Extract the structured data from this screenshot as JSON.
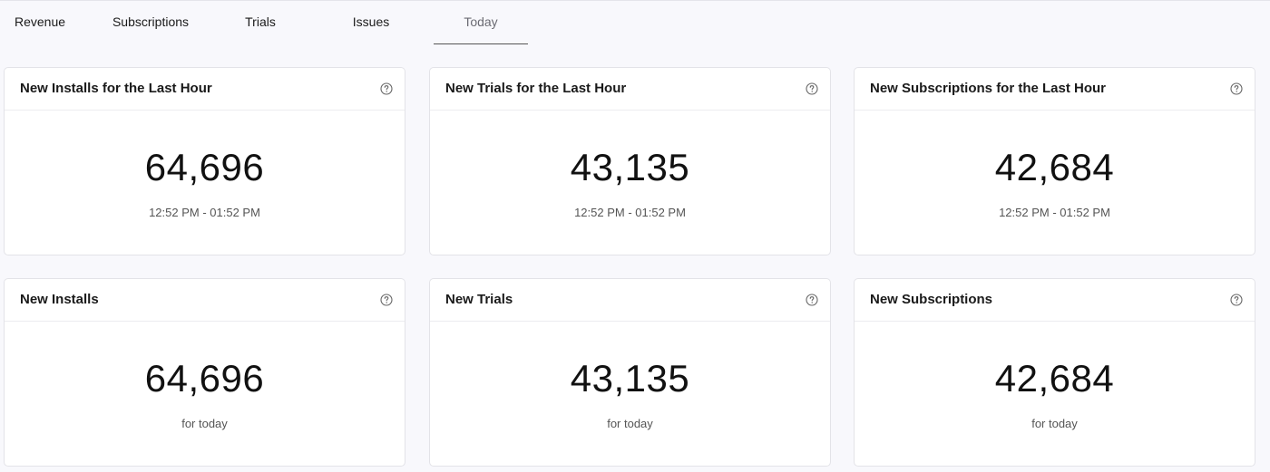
{
  "tabs": [
    {
      "label": "Revenue"
    },
    {
      "label": "Subscriptions"
    },
    {
      "label": "Trials"
    },
    {
      "label": "Issues"
    },
    {
      "label": "Today",
      "active": true
    }
  ],
  "cards": [
    {
      "title": "New Installs for the Last Hour",
      "value": "64,696",
      "subtitle": "12:52 PM - 01:52 PM",
      "icon": "help-circle-icon"
    },
    {
      "title": "New Trials for the Last Hour",
      "value": "43,135",
      "subtitle": "12:52 PM - 01:52 PM",
      "icon": "help-circle-icon"
    },
    {
      "title": "New Subscriptions for the Last Hour",
      "value": "42,684",
      "subtitle": "12:52 PM - 01:52 PM",
      "icon": "help-circle-icon"
    },
    {
      "title": "New Installs",
      "value": "64,696",
      "subtitle": "for today",
      "icon": "help-circle-icon"
    },
    {
      "title": "New Trials",
      "value": "43,135",
      "subtitle": "for today",
      "icon": "help-circle-icon"
    },
    {
      "title": "New Subscriptions",
      "value": "42,684",
      "subtitle": "for today",
      "icon": "help-circle-icon"
    }
  ],
  "colors": {
    "background": "#f8f8fc",
    "card": "#ffffff",
    "border": "#e3e3e8",
    "active_tab_text": "#6b6b73"
  }
}
